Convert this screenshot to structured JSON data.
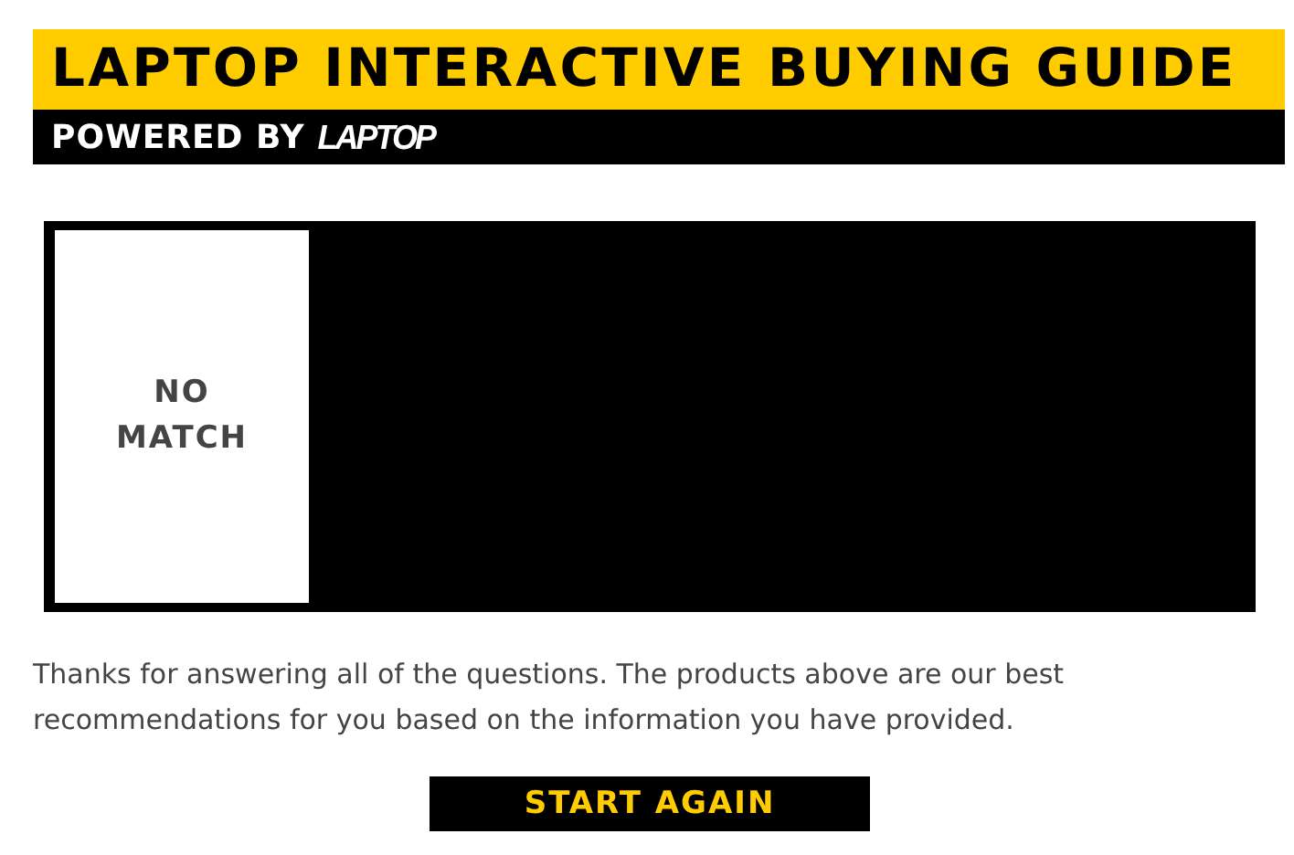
{
  "header": {
    "title": "LAPTOP INTERACTIVE BUYING GUIDE",
    "powered_by": "POWERED BY",
    "logo": "LAPTOP"
  },
  "products": [
    {
      "label": "NO MATCH"
    }
  ],
  "message": "Thanks for answering all of the questions. The products above are our best recommendations for you based on the information you have provided.",
  "button": "START AGAIN"
}
